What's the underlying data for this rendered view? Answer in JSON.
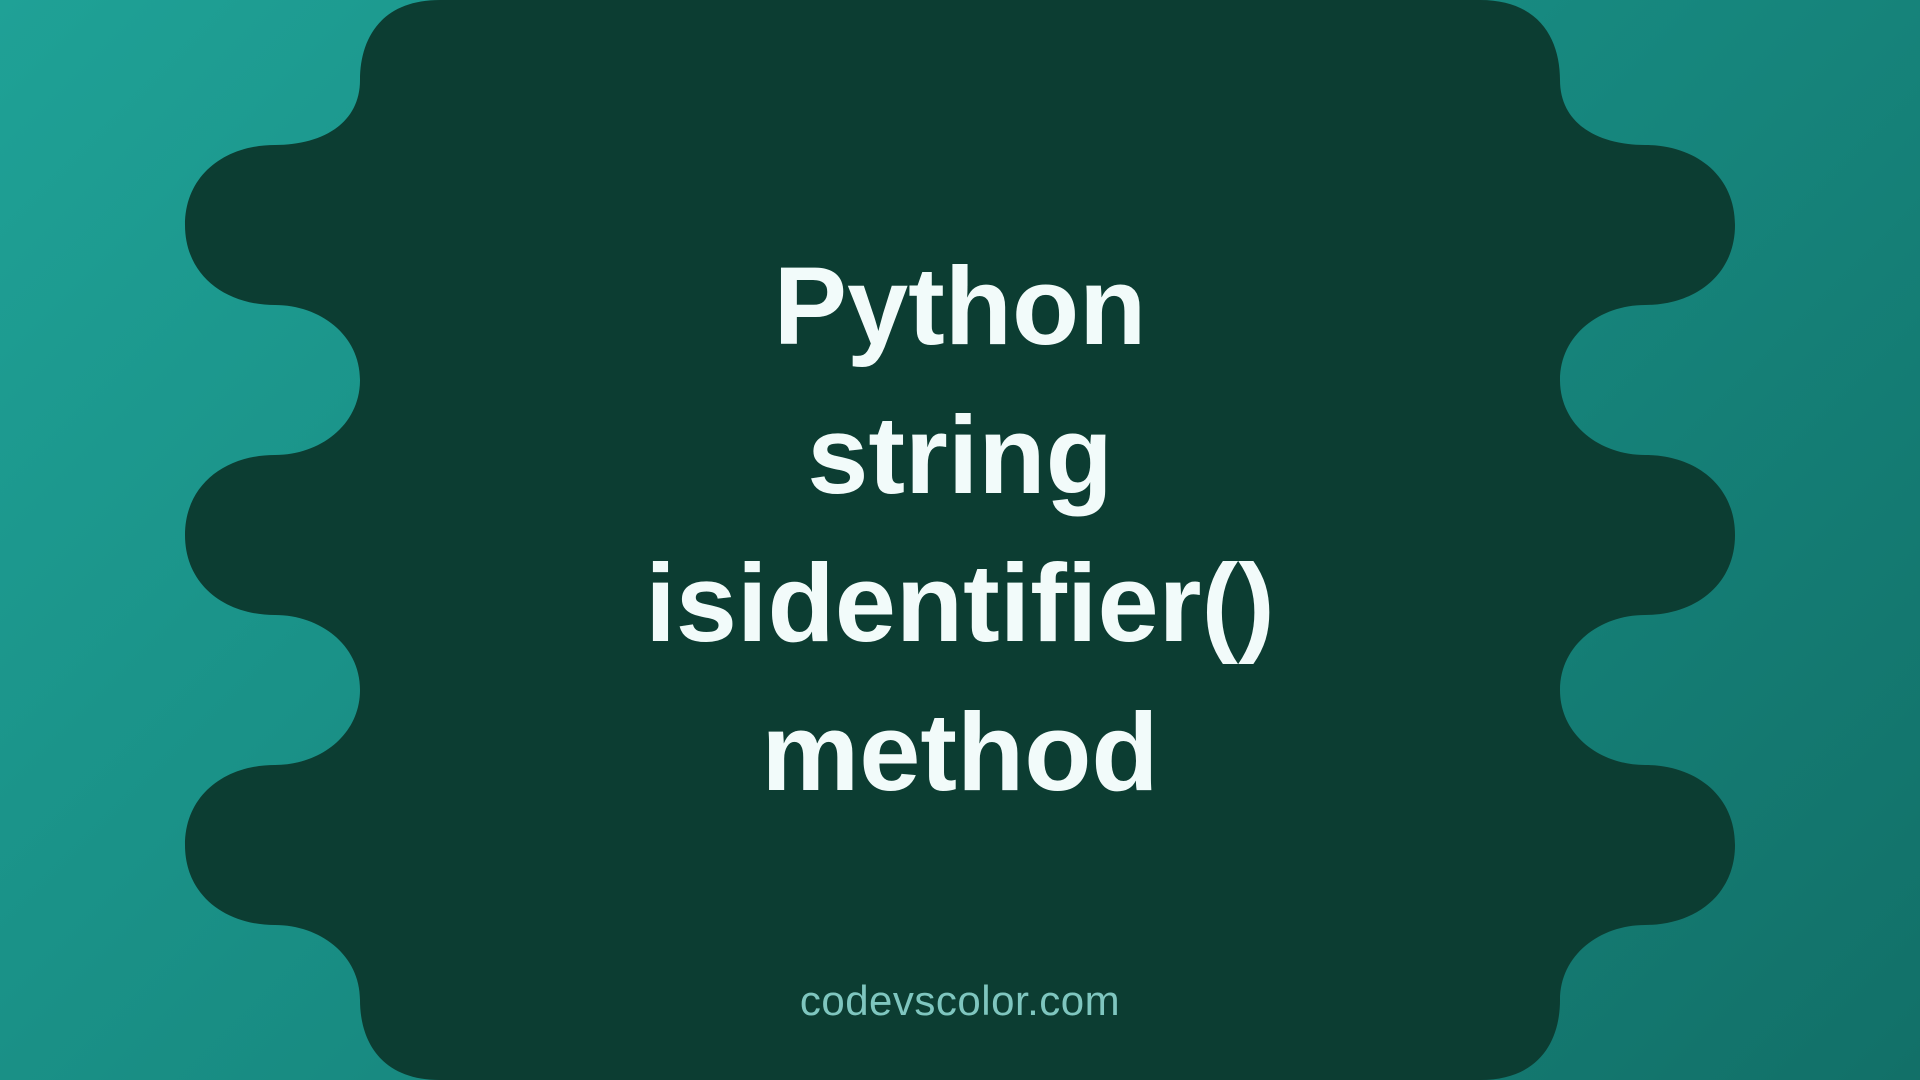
{
  "colors": {
    "bg_top": "#1fa196",
    "bg_bottom": "#127068",
    "blob_fill": "#0c3d32",
    "title_text": "#f2fbfa",
    "site_text": "#7fc6bf"
  },
  "title_lines": "Python\nstring\nisidentifier()\nmethod",
  "site_label": "codevscolor.com"
}
